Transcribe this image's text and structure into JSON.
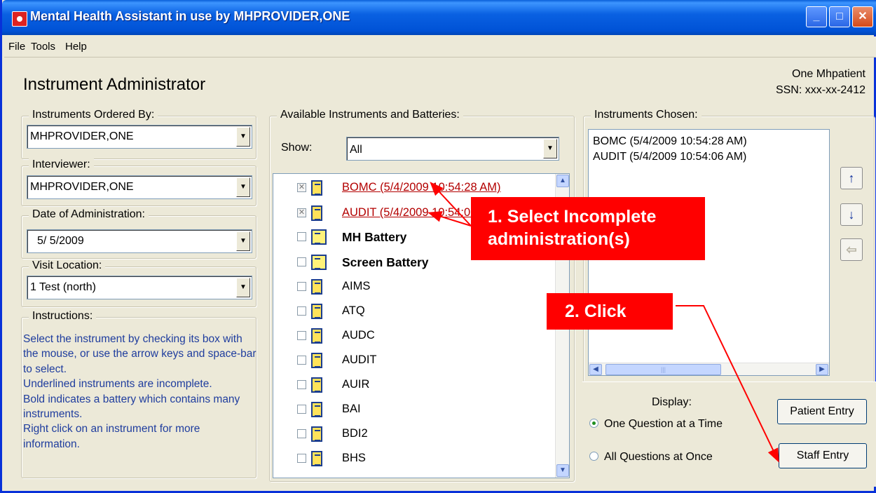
{
  "window": {
    "title": "Mental Health Assistant in use by MHPROVIDER,ONE"
  },
  "menu": {
    "file": "File",
    "tools": "Tools",
    "help": "Help"
  },
  "header": {
    "title": "Instrument Administrator",
    "patient_name": "One Mhpatient",
    "patient_ssn": "SSN: xxx-xx-2412"
  },
  "ordered_by": {
    "label": "Instruments Ordered By:",
    "value": "MHPROVIDER,ONE"
  },
  "interviewer": {
    "label": "Interviewer:",
    "value": "MHPROVIDER,ONE"
  },
  "date_admin": {
    "label": "Date of Administration:",
    "value": "5/ 5/2009"
  },
  "visit_location": {
    "label": "Visit Location:",
    "value": "1 Test (north)"
  },
  "instructions": {
    "label": "Instructions:",
    "text": "Select the instrument by checking its box with the mouse, or use the arrow keys and space-bar to select.\n  Underlined instruments are incomplete.\n  Bold indicates a battery which contains many instruments.\n  Right click on an instrument for more information."
  },
  "available": {
    "label": "Available Instruments and Batteries:",
    "show_label": "Show:",
    "show_value": "All",
    "items": [
      {
        "label": "BOMC  (5/4/2009 10:54:28 AM)",
        "type": "incomplete",
        "checked": true
      },
      {
        "label": "AUDIT  (5/4/2009 10:54:06 AM)",
        "type": "incomplete",
        "checked": true
      },
      {
        "label": "MH Battery",
        "type": "battery",
        "checked": false
      },
      {
        "label": "Screen Battery",
        "type": "battery",
        "checked": false
      },
      {
        "label": "AIMS",
        "type": "normal",
        "checked": false
      },
      {
        "label": "ATQ",
        "type": "normal",
        "checked": false
      },
      {
        "label": "AUDC",
        "type": "normal",
        "checked": false
      },
      {
        "label": "AUDIT",
        "type": "normal",
        "checked": false
      },
      {
        "label": "AUIR",
        "type": "normal",
        "checked": false
      },
      {
        "label": "BAI",
        "type": "normal",
        "checked": false
      },
      {
        "label": "BDI2",
        "type": "normal",
        "checked": false
      },
      {
        "label": "BHS",
        "type": "normal",
        "checked": false
      }
    ]
  },
  "chosen": {
    "label": "Instruments Chosen:",
    "items": [
      "BOMC  (5/4/2009 10:54:28 AM)",
      "AUDIT  (5/4/2009 10:54:06 AM)"
    ]
  },
  "display": {
    "label": "Display:",
    "option_one": "One Question at a Time",
    "option_all": "All Questions at Once",
    "selected": "One Question at a Time"
  },
  "buttons": {
    "patient_entry": "Patient Entry",
    "staff_entry": "Staff Entry"
  },
  "callouts": {
    "step1": "1. Select Incomplete administration(s)",
    "step1_line1": "1. Select Incomplete",
    "step1_line2": "administration(s)",
    "step2": "2. Click",
    "color": "#ff0000"
  },
  "colors": {
    "title_bar": "#0a61e2",
    "instructions_text": "#1f3d9e",
    "incomplete_item": "#b30000"
  }
}
